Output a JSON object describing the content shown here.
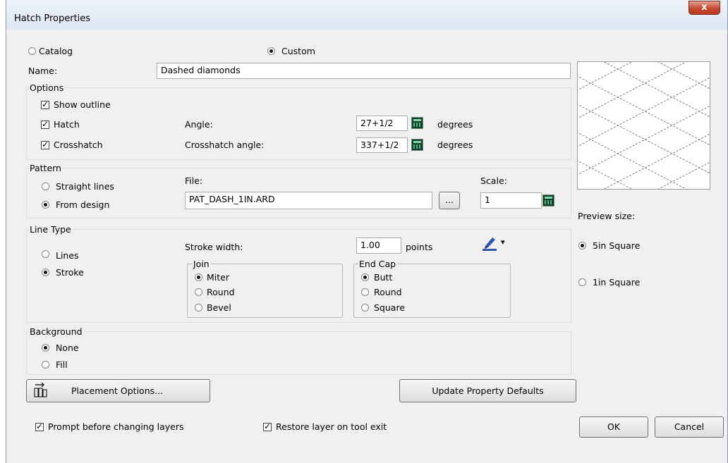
{
  "window": {
    "title": "Hatch Properties",
    "close_symbol": "x"
  },
  "source": {
    "catalog_label": "Catalog",
    "custom_label": "Custom",
    "selected": "Custom"
  },
  "name": {
    "label": "Name:",
    "value": "Dashed diamonds"
  },
  "options": {
    "legend": "Options",
    "show_outline_label": "Show outline",
    "show_outline": true,
    "hatch_label": "Hatch",
    "hatch": true,
    "crosshatch_label": "Crosshatch",
    "crosshatch": true,
    "angle_label": "Angle:",
    "angle_value": "27+1/2",
    "angle_unit": "degrees",
    "crosshatch_angle_label": "Crosshatch angle:",
    "crosshatch_angle_value": "337+1/2",
    "crosshatch_angle_unit": "degrees"
  },
  "pattern": {
    "legend": "Pattern",
    "straight_lines_label": "Straight lines",
    "from_design_label": "From design",
    "selected": "From design",
    "file_label": "File:",
    "file_value": "PAT_DASH_1IN.ARD",
    "browse_label": "...",
    "scale_label": "Scale:",
    "scale_value": "1"
  },
  "line_type": {
    "legend": "Line Type",
    "lines_label": "Lines",
    "stroke_label": "Stroke",
    "selected": "Stroke",
    "stroke_width_label": "Stroke width:",
    "stroke_width_value": "1.00",
    "stroke_width_unit": "points",
    "pen_menu_arrow": "▾",
    "join": {
      "legend": "Join",
      "options": [
        "Miter",
        "Round",
        "Bevel"
      ],
      "selected": "Miter"
    },
    "end_cap": {
      "legend": "End Cap",
      "options": [
        "Butt",
        "Round",
        "Square"
      ],
      "selected": "Butt"
    }
  },
  "background": {
    "legend": "Background",
    "none_label": "None",
    "fill_label": "Fill",
    "selected": "None"
  },
  "buttons": {
    "placement_options": "Placement Options...",
    "update_defaults": "Update Property Defaults",
    "ok": "OK",
    "cancel": "Cancel"
  },
  "preview": {
    "size_label": "Preview size:",
    "five_in_label": "5in Square",
    "one_in_label": "1in Square",
    "selected": "5in Square"
  },
  "footer": {
    "prompt_layers_label": "Prompt before changing layers",
    "prompt_layers": true,
    "restore_layer_label": "Restore layer on tool exit",
    "restore_layer": true
  },
  "icons": [
    "close-icon",
    "calculator-icon",
    "pen-color-icon",
    "placement-options-icon"
  ],
  "colors": {
    "accent_close": "#c6482f",
    "calculator": "#0f3f2a",
    "pen": "#2b55b5"
  }
}
